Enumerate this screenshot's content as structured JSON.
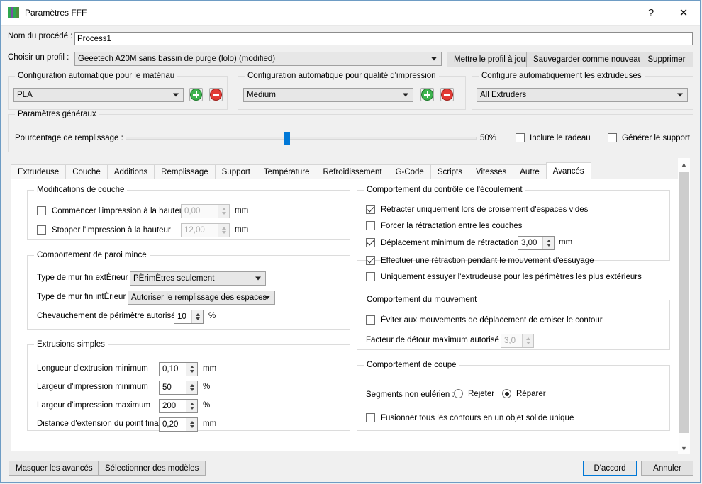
{
  "window": {
    "title": "Paramètres FFF",
    "help_label": "?",
    "close_label": "✕"
  },
  "header": {
    "process_name_label": "Nom du procédé :",
    "process_name_value": "Process1",
    "profile_label": "Choisir un profil :",
    "profile_value": "Geeetech A20M sans bassin de purge (lolo) (modified)",
    "update_profile_button": "Mettre le profil à jour",
    "save_as_new_button": "Sauvegarder comme nouveau",
    "delete_button": "Supprimer"
  },
  "auto_config": {
    "material": {
      "title": "Configuration automatique pour le matériau",
      "value": "PLA",
      "add_icon": "plus-circle-icon",
      "remove_icon": "minus-circle-icon"
    },
    "quality": {
      "title": "Configuration automatique pour qualité d'impression",
      "value": "Medium",
      "add_icon": "plus-circle-icon",
      "remove_icon": "minus-circle-icon"
    },
    "extruders": {
      "title": "Configure automatiquement les extrudeuses",
      "value": "All Extruders"
    }
  },
  "general": {
    "title": "Paramètres généraux",
    "infill_label": "Pourcentage de remplissage :",
    "infill_value": "50%",
    "infill_percent": 50,
    "raft_label": "Inclure le radeau",
    "raft_checked": false,
    "support_label": "Générer le support",
    "support_checked": false
  },
  "tabs": [
    {
      "label": "Extrudeuse",
      "active": false
    },
    {
      "label": "Couche",
      "active": false
    },
    {
      "label": "Additions",
      "active": false
    },
    {
      "label": "Remplissage",
      "active": false
    },
    {
      "label": "Support",
      "active": false
    },
    {
      "label": "Température",
      "active": false
    },
    {
      "label": "Refroidissement",
      "active": false
    },
    {
      "label": "G-Code",
      "active": false
    },
    {
      "label": "Scripts",
      "active": false
    },
    {
      "label": "Vitesses",
      "active": false
    },
    {
      "label": "Autre",
      "active": false
    },
    {
      "label": "Avancés",
      "active": true
    }
  ],
  "layer_mods": {
    "title": "Modifications de couche",
    "start_label": "Commencer l'impression à la hauteur",
    "start_checked": false,
    "start_value": "0,00",
    "start_unit": "mm",
    "stop_label": "Stopper  l'impression à la hauteur",
    "stop_checked": false,
    "stop_value": "12,00",
    "stop_unit": "mm"
  },
  "thin_wall": {
    "title": "Comportement de paroi mince",
    "exterior_label": "Type de mur fin extÈrieur",
    "exterior_value": "PÈrimÈtres seulement",
    "interior_label": "Type de mur fin intÈrieur",
    "interior_value": "Autoriser le remplissage des espaces",
    "overlap_label": "Chevauchement de périmètre autorisé",
    "overlap_value": "10",
    "overlap_unit": "%"
  },
  "single_extrusions": {
    "title": "Extrusions simples",
    "rows": [
      {
        "label": "Longueur d'extrusion minimum",
        "value": "0,10",
        "unit": "mm"
      },
      {
        "label": "Largeur d'impression minimum",
        "value": "50",
        "unit": "%"
      },
      {
        "label": "Largeur d'impression maximum",
        "value": "200",
        "unit": "%"
      },
      {
        "label": "Distance d'extension du point final",
        "value": "0,20",
        "unit": "mm"
      }
    ]
  },
  "flow_control": {
    "title": "Comportement du contrôle de l'écoulement",
    "cb1_label": "Rétracter uniquement lors de croisement d'espaces vides",
    "cb1_checked": true,
    "cb2_label": "Forcer la rétractation entre les couches",
    "cb2_checked": false,
    "cb3_label": "Déplacement minimum de rétractation",
    "cb3_checked": true,
    "cb3_value": "3,00",
    "cb3_unit": "mm",
    "cb4_label": "Effectuer une rétraction pendant le mouvement d'essuyage",
    "cb4_checked": true,
    "cb5_label": "Uniquement essuyer l'extrudeuse pour les périmètres les plus extérieurs",
    "cb5_checked": false
  },
  "movement": {
    "title": "Comportement du mouvement",
    "avoid_label": "Éviter aux mouvements de déplacement de croiser le contour",
    "avoid_checked": false,
    "detour_label": "Facteur de détour maximum autorisé",
    "detour_value": "3,0"
  },
  "slicing": {
    "title": "Comportement de coupe",
    "segments_label": "Segments non eulérien :",
    "reject_label": "Rejeter",
    "reject_checked": false,
    "repair_label": "Réparer",
    "repair_checked": true,
    "merge_label": "Fusionner tous les contours en un objet solide unique",
    "merge_checked": false
  },
  "footer": {
    "hide_advanced_button": "Masquer les avancés",
    "select_models_button": "Sélectionner des modèles",
    "ok_button": "D'accord",
    "cancel_button": "Annuler"
  },
  "colors": {
    "accent": "#0078d7",
    "green": "#3eb34f",
    "red": "#e23b35",
    "window_bg": "#f0f0f0",
    "panel_bg": "#ffffff"
  }
}
